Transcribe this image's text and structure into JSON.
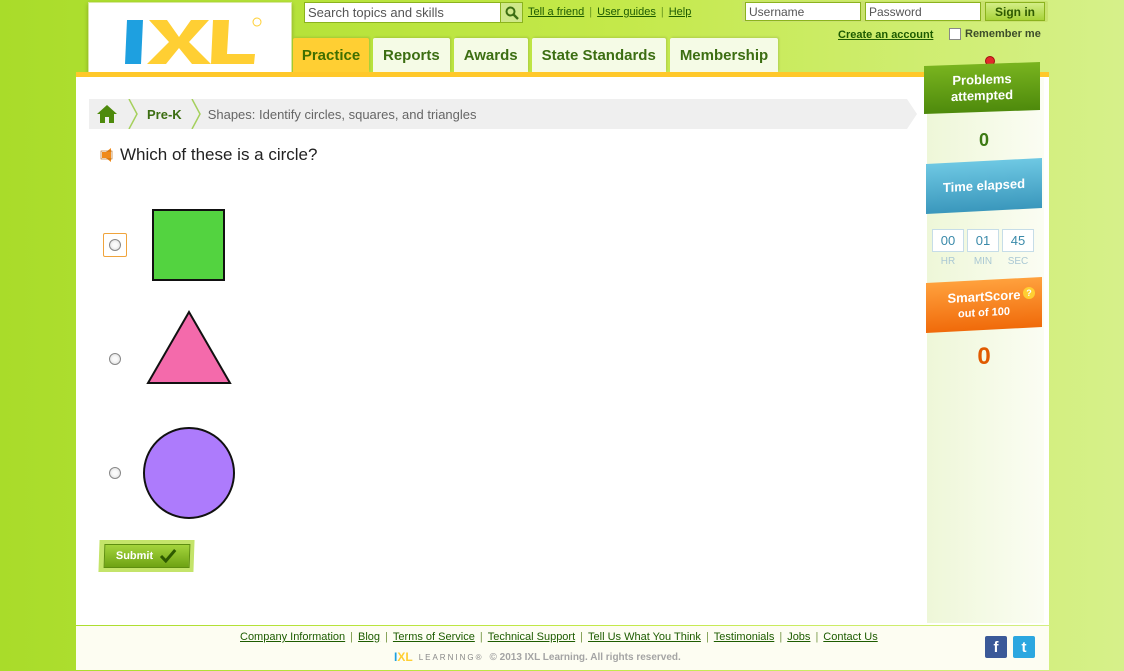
{
  "header": {
    "logo_text": "IXL",
    "search": {
      "placeholder": "Search topics and skills"
    },
    "top_links": [
      "Tell a friend",
      "User guides",
      "Help"
    ],
    "login": {
      "username_placeholder": "Username",
      "password_placeholder": "Password",
      "signin_label": "Sign in"
    },
    "create_account": "Create an account",
    "remember_me": "Remember me"
  },
  "tabs": [
    {
      "label": "Practice",
      "active": true
    },
    {
      "label": "Reports",
      "active": false
    },
    {
      "label": "Awards",
      "active": false
    },
    {
      "label": "State Standards",
      "active": false
    },
    {
      "label": "Membership",
      "active": false
    }
  ],
  "breadcrumb": {
    "grade": "Pre-K",
    "skill": "Shapes: Identify circles, squares, and triangles"
  },
  "question": {
    "text": "Which of these is a circle?"
  },
  "options": [
    {
      "shape": "square",
      "color": "#53d340"
    },
    {
      "shape": "triangle",
      "color": "#f46aab"
    },
    {
      "shape": "circle",
      "color": "#ad7bfc"
    }
  ],
  "submit_label": "Submit",
  "sidebar": {
    "problems_label_1": "Problems",
    "problems_label_2": "attempted",
    "problems_value": "0",
    "time_label": "Time elapsed",
    "time": {
      "hr": "00",
      "min": "01",
      "sec": "45"
    },
    "time_units": {
      "hr": "HR",
      "min": "MIN",
      "sec": "SEC"
    },
    "smartscore_label": "SmartScore",
    "smartscore_sub": "out of 100",
    "smartscore_value": "0",
    "help_symbol": "?"
  },
  "footer": {
    "links": [
      "Company Information",
      "Blog",
      "Terms of Service",
      "Technical Support",
      "Tell Us What You Think",
      "Testimonials",
      "Jobs",
      "Contact Us"
    ],
    "learning": "LEARNING®",
    "copyright": "© 2013 IXL Learning. All rights reserved.",
    "social": {
      "facebook": "f",
      "twitter": "t"
    }
  },
  "colors": {
    "accent_green": "#8cc21f",
    "tab_active": "#ffcf33",
    "brand_blue": "#1ea0e0",
    "brand_yellow": "#ffcf33"
  }
}
